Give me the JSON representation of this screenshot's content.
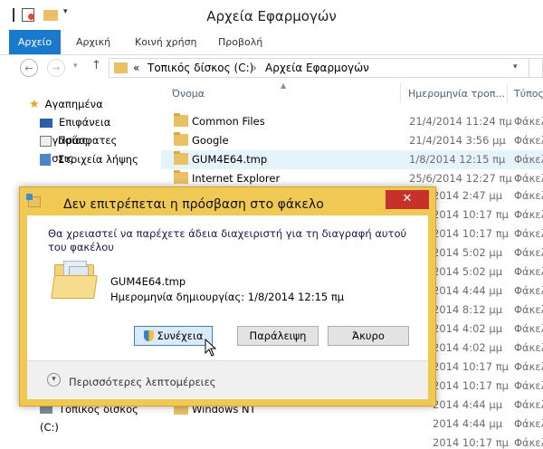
{
  "window": {
    "title": "Αρχεία Εφαρμογών"
  },
  "ribbon": {
    "tabs": [
      "Αρχείο",
      "Αρχική",
      "Κοινή χρήση",
      "Προβολή"
    ]
  },
  "address": {
    "prefix": "«",
    "path": [
      "Τοπικός δίσκος (C:)",
      "Αρχεία Εφαρμογών"
    ],
    "separator": "›"
  },
  "navpane": {
    "favorites": "Αγαπημένα",
    "items": [
      "Επιφάνεια εργασίας",
      "Πρόσφατες θέσεις",
      "Στοιχεία λήψης"
    ],
    "bottom_partial": "Τοπικός δίσκος (C:)"
  },
  "columns": {
    "name": "Όνομα",
    "date": "Ημερομηνία τροπ...",
    "type": "Τύπος"
  },
  "files": [
    {
      "name": "Common Files",
      "date": "21/4/2014 11:24 πμ",
      "type": "Φάκελ"
    },
    {
      "name": "Google",
      "date": "21/4/2014 3:56 μμ",
      "type": "Φάκελ"
    },
    {
      "name": "GUM4E64.tmp",
      "date": "1/8/2014 12:15 πμ",
      "type": "Φάκελ"
    },
    {
      "name": "Internet Explorer",
      "date": "25/6/2014 12:27 πμ",
      "type": "Φάκελ"
    }
  ],
  "hidden_dates": [
    "2014 2:47 μμ",
    "2014 10:17 πμ",
    "2014 10:17 πμ",
    "2014 5:02 μμ",
    "2014 5:02 μμ",
    "2014 4:44 μμ",
    "2014 8:12 μμ",
    "2014 4:02 μμ",
    "2014 4:02 μμ",
    "2014 10:17 πμ",
    "2014 10:17 πμ",
    "2014 4:44 μμ",
    "2014 4:44 μμ",
    "2014 10:17 πμ"
  ],
  "bottom_file": "Windows NT",
  "dialog": {
    "title": "Δεν επιτρέπεται η πρόσβαση στο φάκελο",
    "close": "✕",
    "message": "Θα χρειαστεί να παρέχετε άδεια διαχειριστή για τη διαγραφή αυτού του φακέλου",
    "file_name": "GUM4E64.tmp",
    "file_date": "Ημερομηνία δημιουργίας: 1/8/2014 12:15 πμ",
    "buttons": {
      "continue": "Συνέχεια",
      "skip": "Παράλειψη",
      "cancel": "Άκυρο"
    },
    "more_details": "Περισσότερες λεπτομέρειες"
  }
}
